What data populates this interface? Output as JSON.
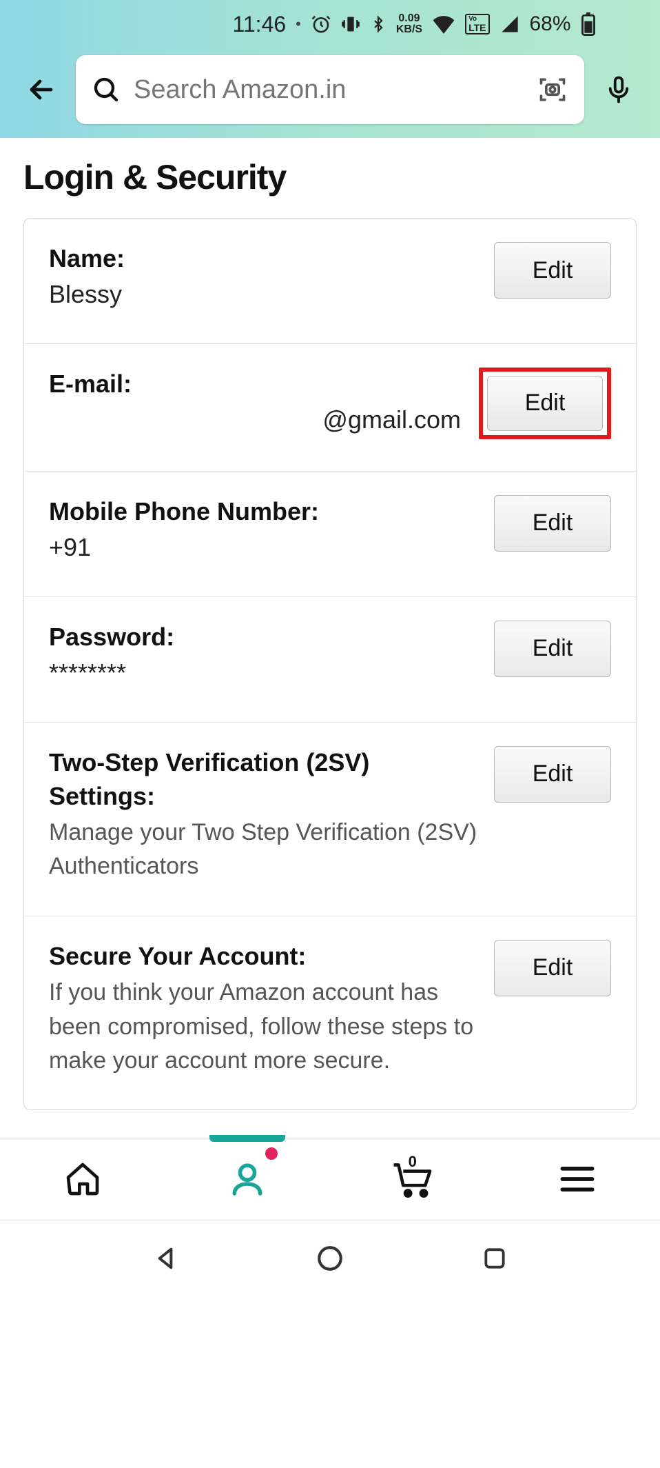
{
  "status": {
    "time": "11:46",
    "netspeed_top": "0.09",
    "netspeed_bottom": "KB/S",
    "lte_label": "LTE",
    "battery_percent": "68%"
  },
  "header": {
    "search_placeholder": "Search Amazon.in"
  },
  "page": {
    "title": "Login & Security"
  },
  "rows": {
    "name": {
      "label": "Name:",
      "value": "Blessy",
      "button": "Edit"
    },
    "email": {
      "label": "E-mail:",
      "value": "@gmail.com",
      "button": "Edit"
    },
    "phone": {
      "label": "Mobile Phone Number:",
      "value": "+91",
      "button": "Edit"
    },
    "password": {
      "label": "Password:",
      "value": "********",
      "button": "Edit"
    },
    "twosv": {
      "label": "Two-Step Verification (2SV) Settings:",
      "desc": "Manage your Two Step Verification (2SV) Authenticators",
      "button": "Edit"
    },
    "secure": {
      "label": "Secure Your Account:",
      "desc": "If you think your Amazon account has been compromised, follow these steps to make your account more secure.",
      "button": "Edit"
    }
  },
  "appnav": {
    "cart_count": "0"
  }
}
